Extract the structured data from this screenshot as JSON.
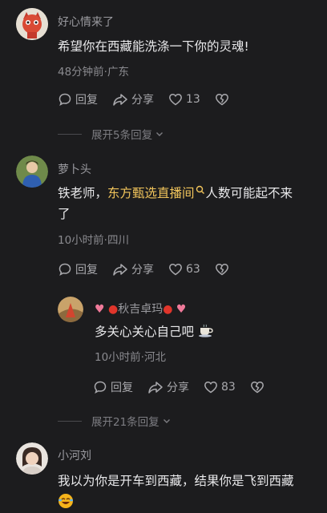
{
  "comments": [
    {
      "username": "好心情来了",
      "text": "希望你在西藏能洗涤一下你的灵魂!",
      "meta": "48分钟前·广东",
      "reply_label": "回复",
      "share_label": "分享",
      "likes": "13",
      "expand_label": "展开5条回复"
    },
    {
      "username": "萝卜头",
      "text_prefix": "铁老师，",
      "link_text": "东方甄选直播间",
      "text_suffix": "人数可能起不来",
      "text_line2": "了",
      "meta": "10小时前·四川",
      "reply_label": "回复",
      "share_label": "分享",
      "likes": "63",
      "reply": {
        "username": "秋吉卓玛",
        "text": "多关心关心自己吧",
        "meta": "10小时前·河北",
        "reply_label": "回复",
        "share_label": "分享",
        "likes": "83"
      },
      "expand_label": "展开21条回复"
    },
    {
      "username": "小河刘",
      "text": "我以为你是开车到西藏，结果你是飞到西藏"
    }
  ],
  "colors": {
    "background": "#1c1c1e",
    "link": "#f1c45b",
    "text": "#e9e9eb",
    "muted": "#8b8b90"
  }
}
